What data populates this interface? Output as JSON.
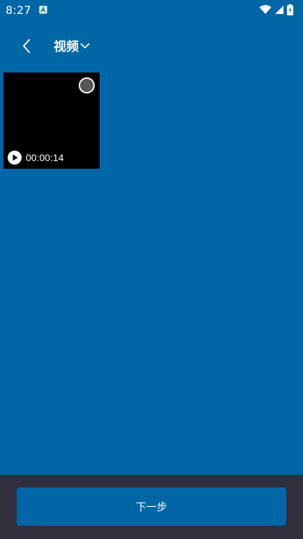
{
  "status_bar": {
    "time": "8:27",
    "app_notification_icon": "a-letter-icon",
    "wifi_icon": "wifi-icon",
    "signal_icon": "signal-icon",
    "battery_icon": "battery-charging-icon"
  },
  "header": {
    "back_icon": "chevron-left-icon",
    "album_title": "视频",
    "dropdown_icon": "chevron-down-icon"
  },
  "media": [
    {
      "type": "video",
      "duration": "00:00:14",
      "selected": false
    }
  ],
  "footer": {
    "next_label": "下一步"
  },
  "colors": {
    "background": "#0066a6",
    "bottom_bar": "#302f3b",
    "button": "#0066a6",
    "text": "#ffffff"
  }
}
